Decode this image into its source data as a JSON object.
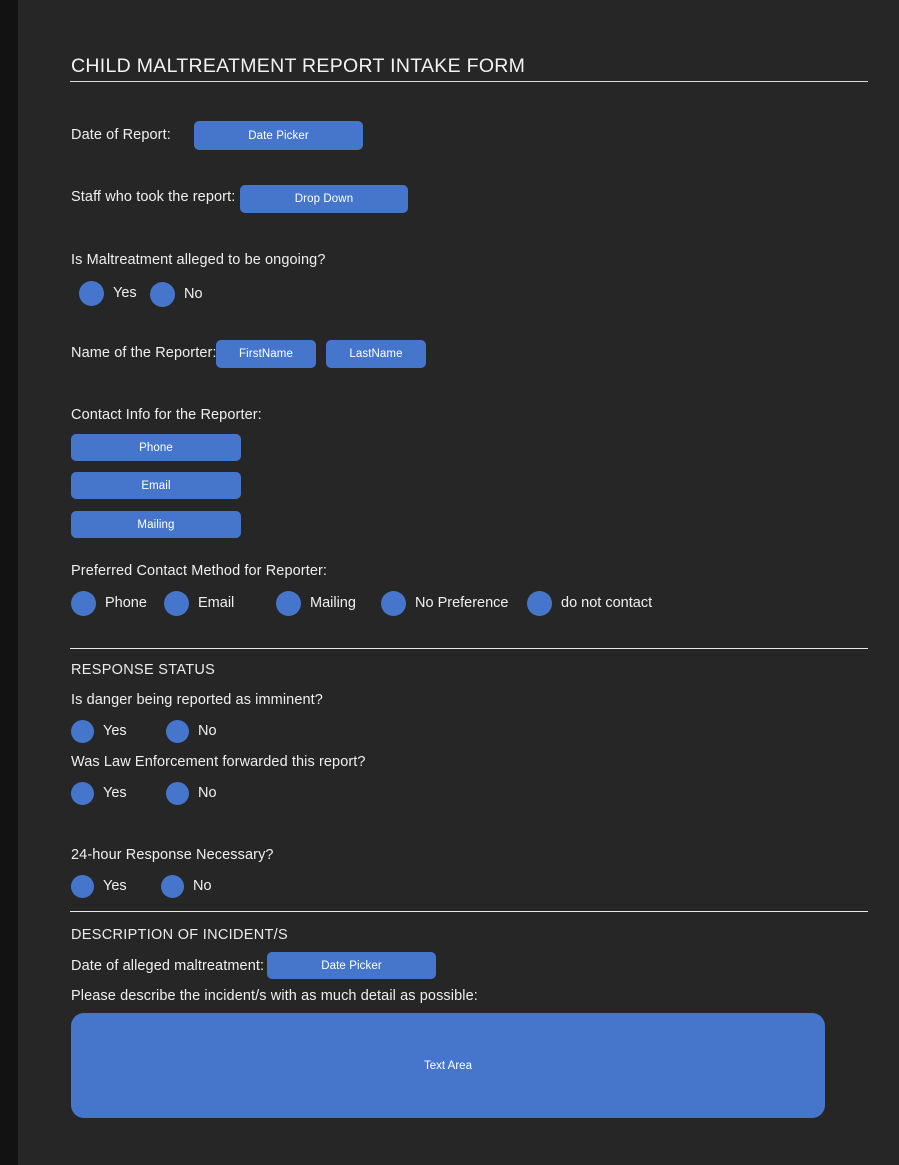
{
  "form": {
    "title": "CHILD MALTREATMENT REPORT INTAKE FORM",
    "accent_color": "#4676cb",
    "background_color": "#262626",
    "text_color": "#efefef"
  },
  "date_of_report": {
    "label": "Date of Report:",
    "picker_label": "Date Picker"
  },
  "staff": {
    "label": "Staff who took the report:",
    "dropdown_label": "Drop Down"
  },
  "ongoing": {
    "question": "Is Maltreatment alleged to be ongoing?",
    "options": [
      {
        "label": "Yes"
      },
      {
        "label": "No"
      }
    ]
  },
  "reporter_name": {
    "label": "Name of the Reporter:",
    "first_name_label": "FirstName",
    "last_name_label": "LastName"
  },
  "contact_info": {
    "label": "Contact Info for the Reporter:",
    "fields": [
      {
        "label": "Phone"
      },
      {
        "label": "Email"
      },
      {
        "label": "Mailing"
      }
    ]
  },
  "preferred_contact": {
    "label": "Preferred Contact Method for Reporter:",
    "options": [
      {
        "label": "Phone"
      },
      {
        "label": "Email"
      },
      {
        "label": "Mailing"
      },
      {
        "label": "No Preference"
      },
      {
        "label": "do not contact"
      }
    ]
  },
  "response_status": {
    "heading": "RESPONSE STATUS",
    "imminent": {
      "question": "Is danger being reported as imminent?",
      "options": [
        {
          "label": "Yes"
        },
        {
          "label": "No"
        }
      ]
    },
    "law_enforcement": {
      "question": "Was Law Enforcement forwarded this report?",
      "options": [
        {
          "label": "Yes"
        },
        {
          "label": "No"
        }
      ]
    },
    "response_24h": {
      "question": "24-hour Response Necessary?",
      "options": [
        {
          "label": "Yes"
        },
        {
          "label": "No"
        }
      ]
    }
  },
  "description": {
    "heading": "DESCRIPTION OF INCIDENT/S",
    "date_label": "Date of alleged maltreatment:",
    "date_picker_label": "Date Picker",
    "describe_label": "Please describe the incident/s with as much detail as possible:",
    "textarea_label": "Text Area"
  }
}
